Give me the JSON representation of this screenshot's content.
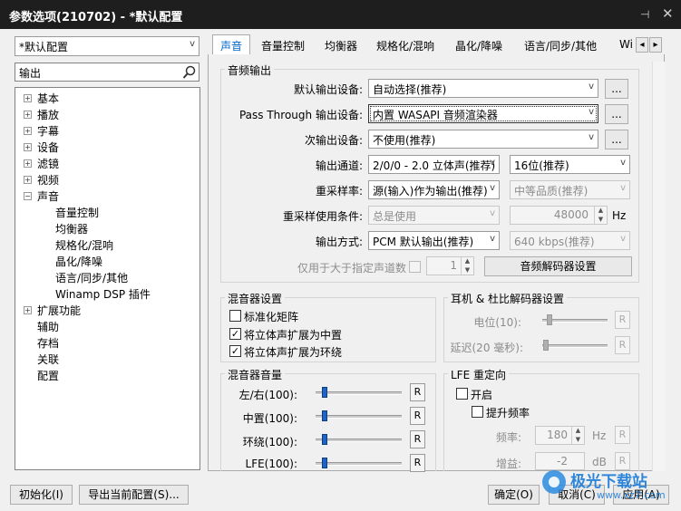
{
  "window": {
    "title": "参数选项(210702) - *默认配置",
    "pin": "⊣",
    "close": "✕"
  },
  "profile": {
    "selected": "*默认配置"
  },
  "search": {
    "value": "输出",
    "placeholder": ""
  },
  "tree": {
    "items": [
      {
        "label": "基本",
        "exp": "+"
      },
      {
        "label": "播放",
        "exp": "+"
      },
      {
        "label": "字幕",
        "exp": "+"
      },
      {
        "label": "设备",
        "exp": "+"
      },
      {
        "label": "滤镜",
        "exp": "+"
      },
      {
        "label": "视频",
        "exp": "+"
      },
      {
        "label": "声音",
        "exp": "−"
      },
      {
        "label": "音量控制"
      },
      {
        "label": "均衡器"
      },
      {
        "label": "规格化/混响"
      },
      {
        "label": "晶化/降噪"
      },
      {
        "label": "语言/同步/其他"
      },
      {
        "label": "Winamp DSP 插件"
      },
      {
        "label": "扩展功能",
        "exp": "+"
      },
      {
        "label": "辅助"
      },
      {
        "label": "存档"
      },
      {
        "label": "关联"
      },
      {
        "label": "配置"
      }
    ]
  },
  "tabs": [
    "声音",
    "音量控制",
    "均衡器",
    "规格化/混响",
    "晶化/降噪",
    "语言/同步/其他",
    "Wi"
  ],
  "tab_scroll": {
    "left": "◂",
    "right": "▸"
  },
  "audio_output": {
    "title": "音频输出",
    "default_device_label": "默认输出设备:",
    "default_device_value": "自动选择(推荐)",
    "passthrough_label": "Pass Through 输出设备:",
    "passthrough_value": "内置 WASAPI 音频渲染器",
    "secondary_label": "次输出设备:",
    "secondary_value": "不使用(推荐)",
    "browse": "...",
    "channel_label": "输出通道:",
    "channel_value": "2/0/0 - 2.0 立体声(推荐)",
    "bits_value": "16位(推荐)",
    "resample_label": "重采样率:",
    "resample_value": "源(输入)作为输出(推荐)",
    "quality_value": "中等品质(推荐)",
    "resample_cond_label": "重采样使用条件:",
    "resample_cond_value": "总是使用",
    "rate_value": "48000",
    "rate_unit": "Hz",
    "mode_label": "输出方式:",
    "mode_value": "PCM 默认输出(推荐)",
    "bitrate_value": "640 kbps(推荐)",
    "only_channels_label": "仅用于大于指定声道数",
    "only_channels_value": "1",
    "decoder_button": "音频解码器设置"
  },
  "mixer": {
    "title": "混音器设置",
    "normalize": "标准化矩阵",
    "stereo_center": "将立体声扩展为中置",
    "stereo_surround": "将立体声扩展为环绕"
  },
  "headphone": {
    "title": "耳机 & 杜比解码器设置",
    "level_label": "电位(10):",
    "delay_label": "延迟(20 毫秒):",
    "reset": "R"
  },
  "mixer_volume": {
    "title": "混音器音量",
    "rows": [
      {
        "label": "左/右(100):",
        "value": 100
      },
      {
        "label": "中置(100):",
        "value": 100
      },
      {
        "label": "环绕(100):",
        "value": 100
      },
      {
        "label": "LFE(100):",
        "value": 100
      }
    ],
    "reset": "R"
  },
  "lfe": {
    "title": "LFE 重定向",
    "enable": "开启",
    "boost": "提升频率",
    "freq_label": "频率:",
    "freq_value": "180",
    "freq_unit": "Hz",
    "gain_label": "增益:",
    "gain_value": "-2",
    "gain_unit": "dB"
  },
  "footer": {
    "init": "初始化(I)",
    "export": "导出当前配置(S)...",
    "ok": "确定(O)",
    "cancel": "取消(C)",
    "apply": "应用(A)"
  },
  "watermark": {
    "text": "极光下载站",
    "url": "www.xz7.com"
  },
  "colors": {
    "accent": "#0066cc",
    "slider_thumb": "#1e63c6",
    "titlebar": "#1e1e1e"
  }
}
